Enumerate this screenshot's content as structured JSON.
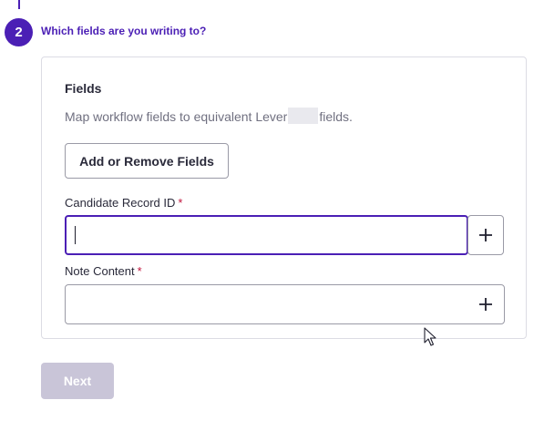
{
  "step": {
    "number": "2",
    "title": "Which fields are you writing to?"
  },
  "card": {
    "heading": "Fields",
    "description_prefix": "Map workflow fields to equivalent Lever",
    "description_suffix": "fields.",
    "add_remove_label": "Add or Remove Fields"
  },
  "fields": [
    {
      "label": "Candidate Record ID",
      "required_marker": "*",
      "value": "",
      "focused": true
    },
    {
      "label": "Note Content",
      "required_marker": "*",
      "value": "",
      "focused": false
    }
  ],
  "footer": {
    "next_label": "Next",
    "next_disabled": true
  },
  "icons": {
    "add_field_1": "plus-icon",
    "add_field_2": "plus-icon",
    "mouse_cursor": "arrow-cursor-icon"
  },
  "colors": {
    "accent": "#4b1fb5",
    "required": "#c0143c",
    "disabled_button": "#c9c5d8"
  }
}
